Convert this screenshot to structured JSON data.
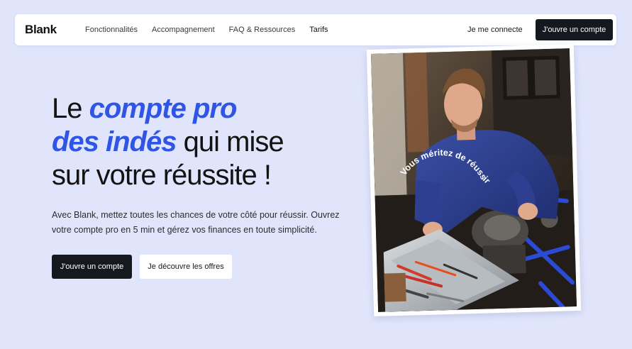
{
  "brand": {
    "logo": "Blank",
    "accent_color": "#2f55e6",
    "dark_color": "#15181e",
    "background_color": "#e0e5fc"
  },
  "nav": {
    "links": [
      {
        "label": "Fonctionnalités"
      },
      {
        "label": "Accompagnement"
      },
      {
        "label": "FAQ & Ressources"
      },
      {
        "label": "Tarifs"
      }
    ],
    "login": "Je me connecte",
    "cta": "J'ouvre un compte"
  },
  "hero": {
    "title_part1": "Le ",
    "title_accent1": "compte pro",
    "title_accent2": "des indés",
    "title_part2": " qui mise",
    "title_part3": "sur votre réussite !",
    "subtitle": "Avec Blank, mettez toutes les chances de votre côté pour réussir. Ouvrez votre compte pro en 5 min et gérez vos finances en toute simplicité.",
    "primary_button": "J'ouvre un compte",
    "secondary_button": "Je découvre les offres"
  },
  "photo": {
    "curved_caption": "Vous méritez de réussir",
    "subject": "mechanic-working-on-motorbike"
  }
}
